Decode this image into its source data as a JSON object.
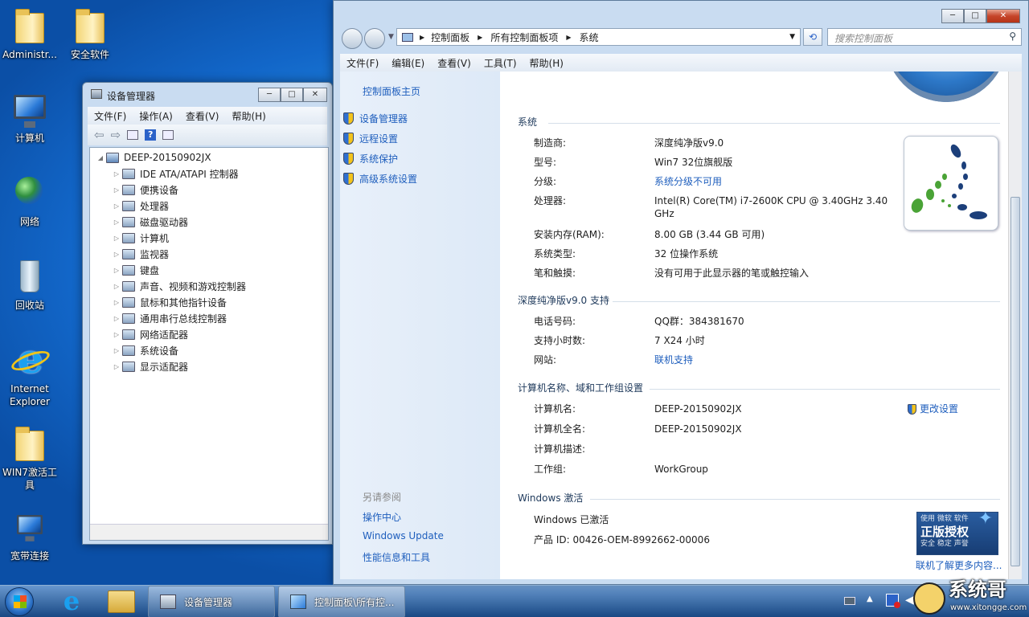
{
  "desktop": {
    "icons": [
      "Administr...",
      "安全软件",
      "计算机",
      "网络",
      "回收站",
      "Internet Explorer",
      "WIN7激活工具",
      "宽带连接"
    ]
  },
  "devmgr": {
    "title": "设备管理器",
    "menu": [
      "文件(F)",
      "操作(A)",
      "查看(V)",
      "帮助(H)"
    ],
    "root": "DEEP-20150902JX",
    "items": [
      "IDE ATA/ATAPI 控制器",
      "便携设备",
      "处理器",
      "磁盘驱动器",
      "计算机",
      "监视器",
      "键盘",
      "声音、视频和游戏控制器",
      "鼠标和其他指针设备",
      "通用串行总线控制器",
      "网络适配器",
      "系统设备",
      "显示适配器"
    ]
  },
  "cp": {
    "breadcrumb": [
      "控制面板",
      "所有控制面板项",
      "系统"
    ],
    "search_placeholder": "搜索控制面板",
    "menu": [
      "文件(F)",
      "编辑(E)",
      "查看(V)",
      "工具(T)",
      "帮助(H)"
    ],
    "left": {
      "home": "控制面板主页",
      "links": [
        "设备管理器",
        "远程设置",
        "系统保护",
        "高级系统设置"
      ],
      "see_also_title": "另请参阅",
      "see_also": [
        "操作中心",
        "Windows Update",
        "性能信息和工具"
      ]
    },
    "system": {
      "header": "系统",
      "rows": [
        {
          "label": "制造商:",
          "value": "深度纯净版v9.0"
        },
        {
          "label": "型号:",
          "value": "Win7 32位旗舰版"
        },
        {
          "label": "分级:",
          "value": "系统分级不可用"
        },
        {
          "label": "处理器:",
          "value": "Intel(R) Core(TM) i7-2600K CPU @ 3.40GHz   3.40",
          "value2": "GHz"
        },
        {
          "label": "安装内存(RAM):",
          "value": "8.00 GB (3.44 GB 可用)"
        },
        {
          "label": "系统类型:",
          "value": "32 位操作系统"
        },
        {
          "label": "笔和触摸:",
          "value": "没有可用于此显示器的笔或触控输入"
        }
      ]
    },
    "support": {
      "header": "深度纯净版v9.0 支持",
      "rows": [
        {
          "label": "电话号码:",
          "value": "QQ群：384381670"
        },
        {
          "label": "支持小时数:",
          "value": "7 X24 小时"
        },
        {
          "label": "网站:",
          "value": "联机支持"
        }
      ]
    },
    "computer": {
      "header": "计算机名称、域和工作组设置",
      "change": "更改设置",
      "rows": [
        {
          "label": "计算机名:",
          "value": "DEEP-20150902JX"
        },
        {
          "label": "计算机全名:",
          "value": "DEEP-20150902JX"
        },
        {
          "label": "计算机描述:",
          "value": ""
        },
        {
          "label": "工作组:",
          "value": "WorkGroup"
        }
      ]
    },
    "activation": {
      "header": "Windows 激活",
      "status": "Windows 已激活",
      "product_id": "产品 ID: 00426-OEM-8992662-00006",
      "badge_top": "使用 微软 软件",
      "badge_main": "正版授权",
      "badge_sub": "安全 稳定 声誉",
      "learn_more": "联机了解更多内容..."
    }
  },
  "taskbar": {
    "tasks": [
      "设备管理器",
      "控制面板\\所有控..."
    ],
    "watermark_text": "系统哥",
    "watermark_url": "www.xitongge.com"
  }
}
